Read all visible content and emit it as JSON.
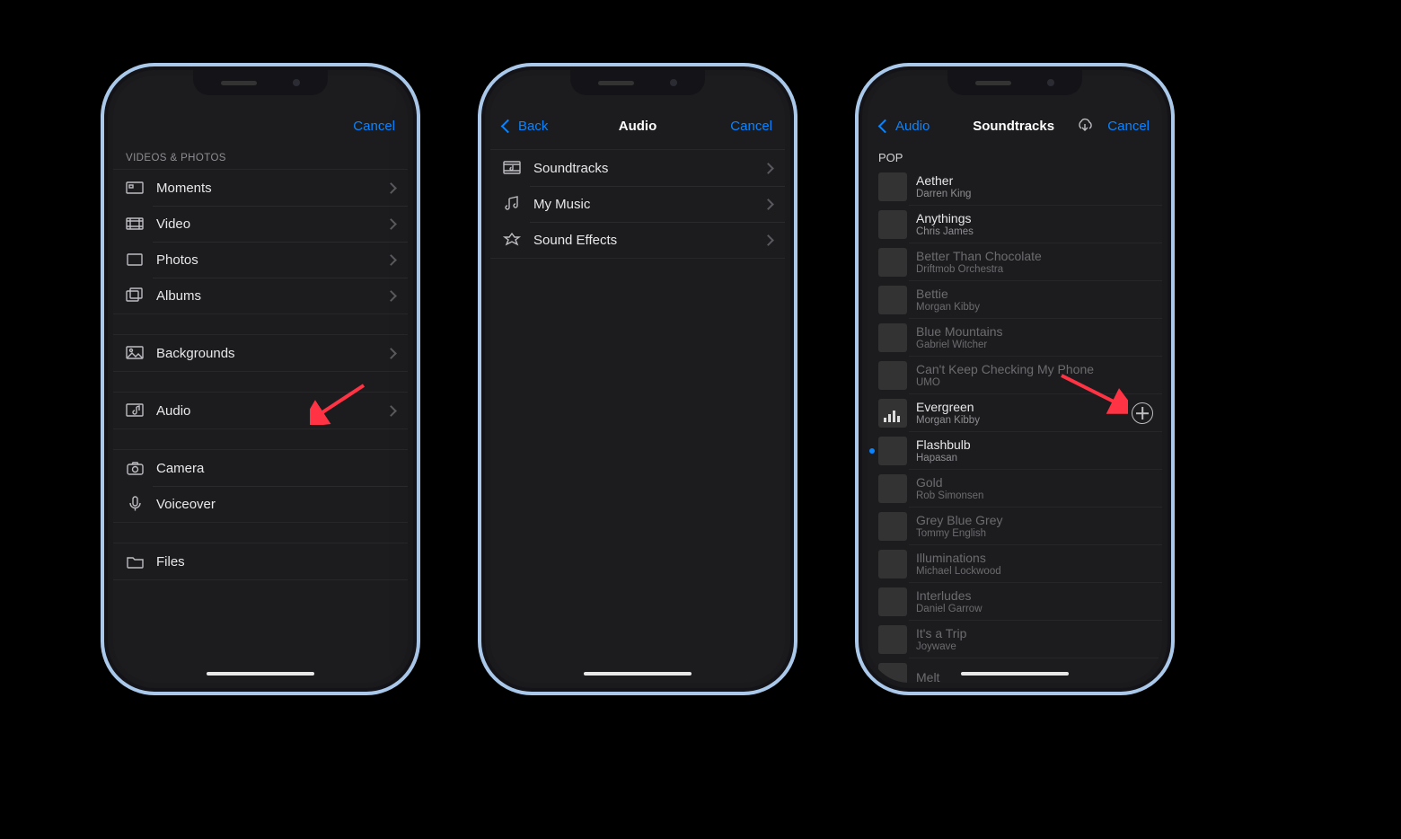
{
  "accent": "#0a84ff",
  "screen1": {
    "cancel": "Cancel",
    "section_header": "VIDEOS & PHOTOS",
    "groups": [
      {
        "items": [
          {
            "icon": "moments",
            "label": "Moments"
          },
          {
            "icon": "video",
            "label": "Video"
          },
          {
            "icon": "photos",
            "label": "Photos"
          },
          {
            "icon": "albums",
            "label": "Albums"
          }
        ]
      },
      {
        "items": [
          {
            "icon": "backgrounds",
            "label": "Backgrounds"
          }
        ]
      },
      {
        "items": [
          {
            "icon": "audio",
            "label": "Audio"
          }
        ]
      },
      {
        "items": [
          {
            "icon": "camera",
            "label": "Camera",
            "no_chevron": true
          },
          {
            "icon": "voiceover",
            "label": "Voiceover",
            "no_chevron": true
          }
        ]
      },
      {
        "items": [
          {
            "icon": "files",
            "label": "Files",
            "no_chevron": true
          }
        ]
      }
    ]
  },
  "screen2": {
    "back": "Back",
    "title": "Audio",
    "cancel": "Cancel",
    "items": [
      {
        "icon": "soundtracks",
        "label": "Soundtracks"
      },
      {
        "icon": "mymusic",
        "label": "My Music"
      },
      {
        "icon": "soundeffects",
        "label": "Sound Effects"
      }
    ]
  },
  "screen3": {
    "back": "Audio",
    "title": "Soundtracks",
    "cancel": "Cancel",
    "category": "POP",
    "tracks": [
      {
        "name": "Aether",
        "artist": "Darren King",
        "cov": "a",
        "dim": false
      },
      {
        "name": "Anythings",
        "artist": "Chris James",
        "cov": "b",
        "dim": false
      },
      {
        "name": "Better Than Chocolate",
        "artist": "Driftmob Orchestra",
        "cov": "c",
        "dim": true
      },
      {
        "name": "Bettie",
        "artist": "Morgan Kibby",
        "cov": "d",
        "dim": true
      },
      {
        "name": "Blue Mountains",
        "artist": "Gabriel Witcher",
        "cov": "e",
        "dim": true
      },
      {
        "name": "Can't Keep Checking My Phone",
        "artist": "UMO",
        "cov": "f",
        "dim": true
      },
      {
        "name": "Evergreen",
        "artist": "Morgan Kibby",
        "cov": "g",
        "dim": false,
        "plus": true
      },
      {
        "name": "Flashbulb",
        "artist": "Hapasan",
        "cov": "h",
        "dim": false,
        "dot": true
      },
      {
        "name": "Gold",
        "artist": "Rob Simonsen",
        "cov": "i",
        "dim": true
      },
      {
        "name": "Grey Blue Grey",
        "artist": "Tommy English",
        "cov": "j",
        "dim": true
      },
      {
        "name": "Illuminations",
        "artist": "Michael Lockwood",
        "cov": "k",
        "dim": true
      },
      {
        "name": "Interludes",
        "artist": "Daniel Garrow",
        "cov": "l",
        "dim": true
      },
      {
        "name": "It's a Trip",
        "artist": "Joywave",
        "cov": "m",
        "dim": true
      },
      {
        "name": "Melt",
        "artist": "",
        "cov": "n",
        "dim": true
      }
    ]
  }
}
